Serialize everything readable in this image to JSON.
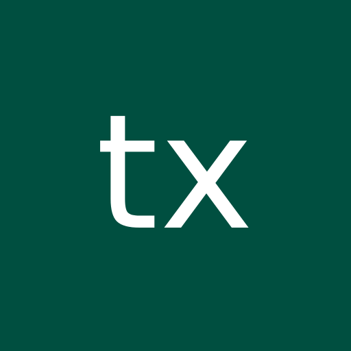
{
  "avatar": {
    "initials": "tx",
    "background_color": "#004F40",
    "text_color": "#FFFFFF"
  }
}
